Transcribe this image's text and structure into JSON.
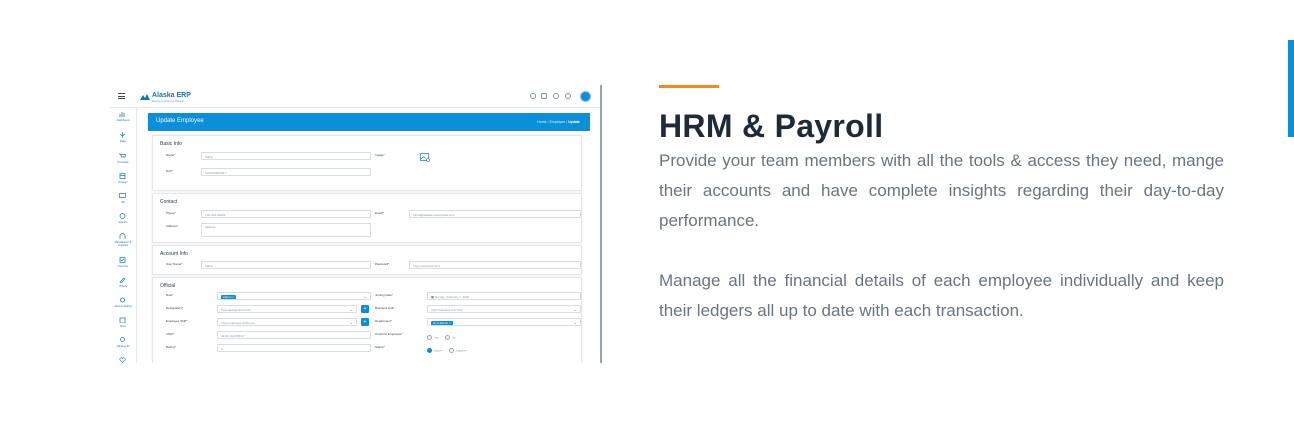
{
  "colors": {
    "accent": "#f08a1c",
    "brand_blue": "#0a8fd8",
    "heading": "#1e2a36",
    "body_text": "#6b7480"
  },
  "section": {
    "heading": "HRM & Payroll",
    "paragraph_1": "Provide your team members with all the tools & access they need, mange their accounts and have complete insights regarding their day-to-day performance.",
    "paragraph_2": "Manage all the financial details of each employee individually and keep their ledgers all up to date with each transaction."
  },
  "screenshot": {
    "brand": {
      "name": "Alaska ERP",
      "tagline": "Enterprise Resource Planner"
    },
    "header_icons": [
      "refresh-icon",
      "monitor-icon",
      "settings-icon",
      "moon-icon"
    ],
    "sidebar": [
      {
        "label": "Dashboard",
        "icon": "bar-chart-icon"
      },
      {
        "label": "Sales",
        "icon": "pen-icon"
      },
      {
        "label": "Purchase",
        "icon": "cart-icon"
      },
      {
        "label": "Product",
        "icon": "box-icon"
      },
      {
        "label": "HR",
        "icon": "people-icon"
      },
      {
        "label": "Reports",
        "icon": "chart-icon"
      },
      {
        "label": "Manufacture & Logistics",
        "icon": "factory-icon"
      },
      {
        "label": "Inventory",
        "icon": "clipboard-icon"
      },
      {
        "label": "Others",
        "icon": "tag-icon"
      },
      {
        "label": "Service Setting",
        "icon": "gear-icon"
      },
      {
        "label": "Store",
        "icon": "store-icon"
      },
      {
        "label": "Manage ID",
        "icon": "idea-icon"
      }
    ],
    "page_title": "Update Employee",
    "breadcrumb": {
      "home": "Home",
      "sep": "/",
      "parent": "Employee",
      "current": "Update"
    },
    "basic_info": {
      "title": "Basic Info",
      "name_label": "Name*",
      "name_value": "Zahra",
      "image_label": "Image*",
      "dob_label": "Dob*",
      "dob_value": "10/07/2003/03-7"
    },
    "contact": {
      "title": "Contact",
      "phone_label": "Phone*",
      "phone_value": "+92-323-33423",
      "email_label": "Email*",
      "email_value": "zahra@alaska-enterprises.com",
      "address_label": "Address*",
      "address_value": "address"
    },
    "account_info": {
      "title": "Account Info",
      "username_label": "User Name*",
      "username_value": "Zahra",
      "password_label": "Password*",
      "password_placeholder": "Type password here"
    },
    "official": {
      "title": "Official",
      "role_label": "Role*",
      "role_chip": "Admin",
      "joining_label": "Joining Date*",
      "joining_value": "Sunday, February 2, 2020",
      "designation_label": "Designation*",
      "designation_placeholder": "Type designation here",
      "business_unit_label": "Business Unit*",
      "business_unit_placeholder": "Type business unit here",
      "shift_label": "Employee Shift*",
      "shift_placeholder": "Type employee shift here",
      "department_label": "Department*",
      "department_chip": "Hr & Admin",
      "cnic_label": "CNIC*",
      "cnic_value": "42101-4421563-7",
      "overtime_label": "Overtime Employee*",
      "overtime_yes": "Yes",
      "overtime_no": "No",
      "rating_label": "Rating*",
      "rating_value": "4",
      "status_label": "Status*",
      "status_active": "Active",
      "status_inactive": "Inactive"
    }
  }
}
